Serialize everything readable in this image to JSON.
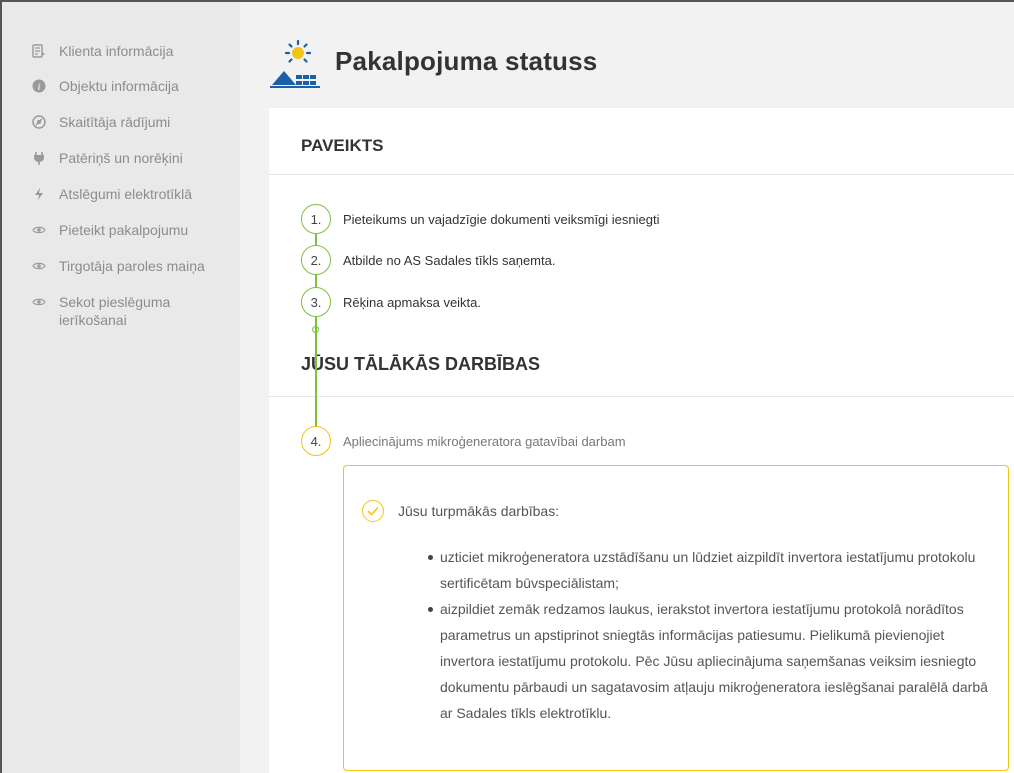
{
  "sidebar": {
    "items": [
      {
        "label": "Klienta informācija",
        "icon": "document-icon"
      },
      {
        "label": "Objektu informācija",
        "icon": "info-icon"
      },
      {
        "label": "Skaitītāja rādījumi",
        "icon": "meter-icon"
      },
      {
        "label": "Patēriņš un norēķini",
        "icon": "plug-icon"
      },
      {
        "label": "Atslēgumi elektrotīklā",
        "icon": "lightning-icon"
      },
      {
        "label": "Pieteikt pakalpojumu",
        "icon": "eye-icon"
      },
      {
        "label": "Tirgotāja paroles maiņa",
        "icon": "eye-icon"
      },
      {
        "label": "Sekot pieslēguma ierīkošanai",
        "icon": "eye-icon"
      }
    ]
  },
  "header": {
    "title": "Pakalpojuma statuss",
    "logo_icon": "solar-panel-icon"
  },
  "completed": {
    "title": "PAVEIKTS",
    "steps": [
      {
        "num": "1.",
        "label": "Pieteikums un vajadzīgie dokumenti veiksmīgi iesniegti"
      },
      {
        "num": "2.",
        "label": "Atbilde no AS Sadales tīkls saņemta."
      },
      {
        "num": "3.",
        "label": "Rēķina apmaksa veikta."
      }
    ]
  },
  "next": {
    "title": "JŪSU TĀLĀKĀS DARBĪBAS",
    "step": {
      "num": "4.",
      "label": "Apliecinājums mikroģeneratora gatavībai darbam"
    },
    "notice": {
      "heading": "Jūsu turpmākās darbības:",
      "bullets": [
        "uzticiet mikroģeneratora uzstādīšanu un lūdziet aizpildīt invertora iestatījumu protokolu sertificētam būvspeciālistam;",
        "aizpildiet zemāk redzamos laukus, ierakstot invertora iestatījumu protokolā norādītos parametrus un apstiprinot sniegtās informācijas patiesumu. Pielikumā pievienojiet invertora iestatījumu protokolu. Pēc Jūsu apliecinājuma saņemšanas veiksim iesniegto dokumentu pārbaudi un sagatavosim atļauju mikroģeneratora ieslēgšanai paralēlā darbā ar Sadales tīkls elektrotīklu."
      ]
    }
  },
  "colors": {
    "done": "#7ac142",
    "pending": "#f2c318",
    "sidebar_bg": "#e9e9e9",
    "main_bg": "#f2f2f2",
    "logo_blue": "#1a5fa8",
    "logo_yellow": "#f2c318"
  }
}
